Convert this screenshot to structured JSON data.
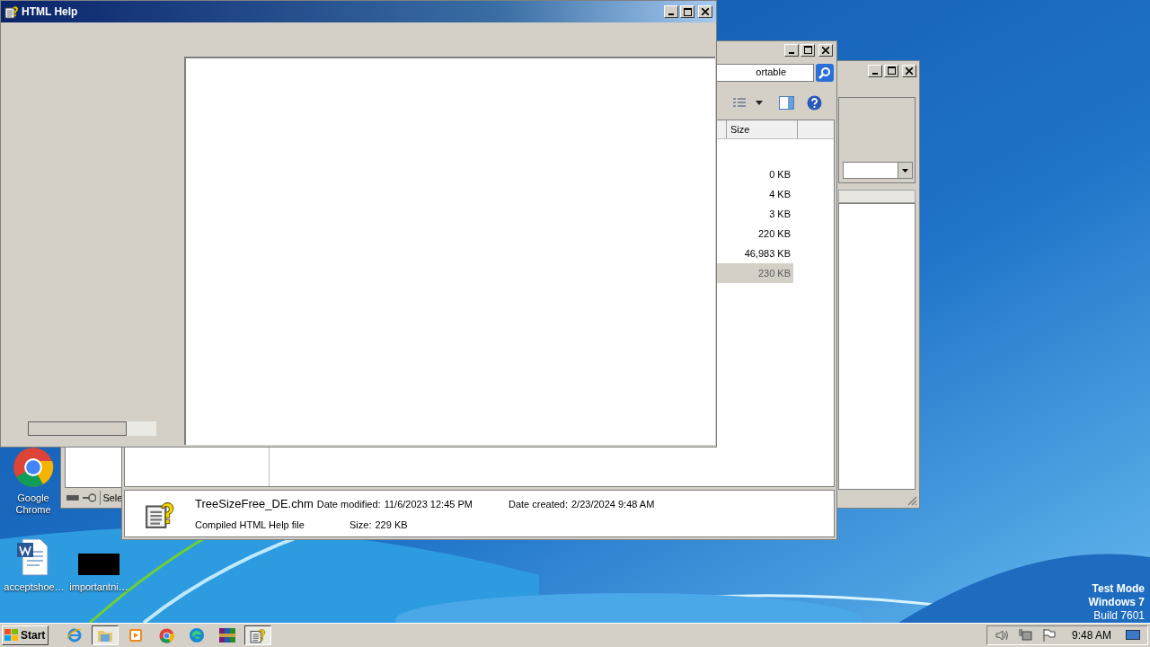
{
  "desktop_icons": [
    {
      "label": "Google Chrome",
      "kind": "chrome"
    },
    {
      "label": "acceptshoe…",
      "kind": "word"
    },
    {
      "label": "importantni…",
      "kind": "blank"
    }
  ],
  "side_window": {
    "status_text": "Sele"
  },
  "explorer_window": {
    "search_value": "ortable",
    "columns": [
      "Size"
    ],
    "rows": [
      {
        "size": "0 KB",
        "selected": false
      },
      {
        "size": "4 KB",
        "selected": false
      },
      {
        "size": "3 KB",
        "selected": false
      },
      {
        "size": "220 KB",
        "selected": false
      },
      {
        "size": "46,983 KB",
        "selected": false
      },
      {
        "size": "230 KB",
        "selected": true
      }
    ],
    "details": {
      "file_name": "TreeSizeFree_DE.chm",
      "file_type": "Compiled HTML Help file",
      "modified_label": "Date modified:",
      "modified_value": "11/6/2023 12:45 PM",
      "size_label": "Size:",
      "size_value": "229 KB",
      "created_label": "Date created:",
      "created_value": "2/23/2024 9:48 AM"
    }
  },
  "help_window": {
    "title": "HTML Help"
  },
  "desktop_notice": [
    "Test Mode",
    "Windows 7",
    "Build 7601"
  ],
  "taskbar": {
    "start": "Start",
    "buttons": [
      {
        "kind": "ie",
        "selected": false
      },
      {
        "kind": "folder",
        "selected": true
      },
      {
        "kind": "media",
        "selected": false
      },
      {
        "kind": "chrome",
        "selected": false
      },
      {
        "kind": "edge",
        "selected": false
      },
      {
        "kind": "archive",
        "selected": false
      },
      {
        "kind": "help",
        "selected": true
      }
    ],
    "clock": "9:48 AM"
  }
}
